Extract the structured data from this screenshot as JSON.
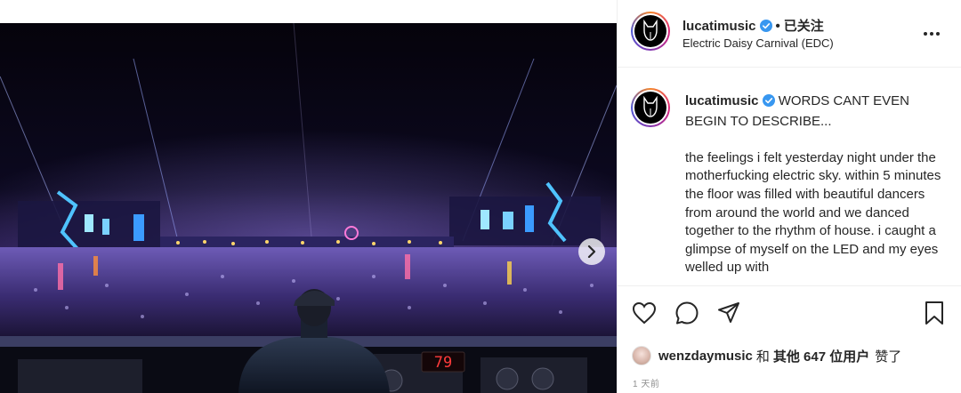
{
  "post": {
    "author": {
      "username": "lucatimusic",
      "verified": true,
      "follow_status": "已关注",
      "location": "Electric Daisy Carnival (EDC)"
    },
    "caption": {
      "username": "lucatimusic",
      "text": "WORDS CANT EVEN BEGIN TO DESCRIBE...\n\nthe feelings i felt yesterday night under the motherfucking electric sky. within 5 minutes the floor was filled with beautiful dancers from around the world and we danced together to the rhythm of house. i caught a glimpse of myself on the LED and my eyes welled up with"
    },
    "media": {
      "cdj_display": "79"
    },
    "likes": {
      "liker": "wenzdaymusic",
      "joiner": "和",
      "others": "其他 647 位用户",
      "suffix": "赞了"
    },
    "timestamp": "1 天前"
  },
  "icons": {
    "verified": "verified-badge-icon",
    "more": "more-options-icon",
    "like": "heart-icon",
    "comment": "comment-icon",
    "share": "paper-plane-icon",
    "save": "bookmark-icon",
    "next": "chevron-right-icon"
  },
  "colors": {
    "verified_blue": "#3897f0",
    "text": "#262626",
    "muted": "#8e8e8e",
    "border": "#efefef"
  }
}
